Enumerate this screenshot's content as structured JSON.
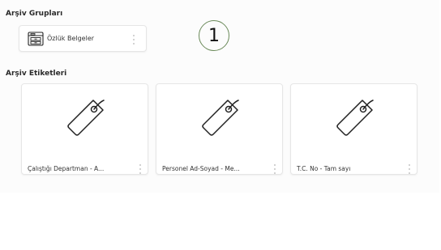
{
  "archive_groups": {
    "title": "Arşiv Grupları",
    "items": [
      {
        "label": "Özlük Belgeler",
        "icon": "folder-cabinet-icon"
      }
    ]
  },
  "step_marker": {
    "label": "1"
  },
  "archive_tags": {
    "title": "Arşiv Etiketleri",
    "items": [
      {
        "label": "Çalıştığı Departman - A...",
        "icon": "tag-icon"
      },
      {
        "label": "Personel Ad-Soyad - Me...",
        "icon": "tag-icon"
      },
      {
        "label": "T.C. No - Tam sayı",
        "icon": "tag-icon"
      }
    ]
  },
  "colors": {
    "marker_border": "#6b8a5a",
    "icon_stroke": "#222222",
    "kebab": "#c4c4c4"
  }
}
